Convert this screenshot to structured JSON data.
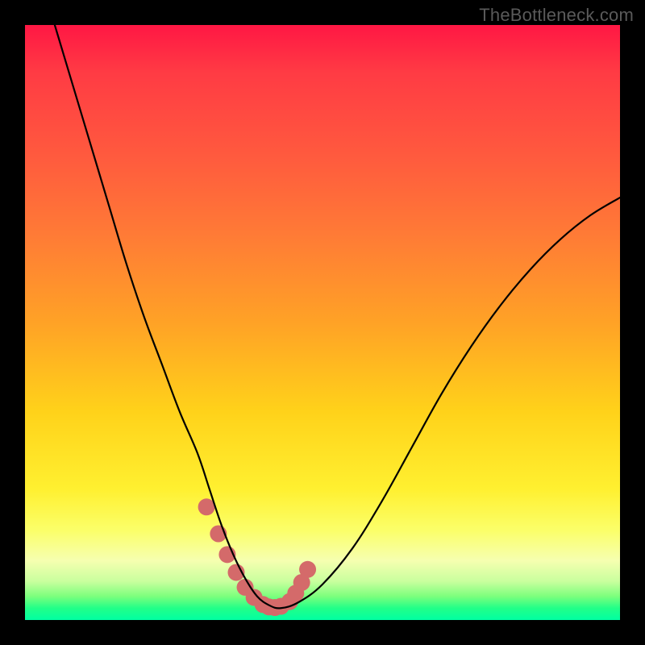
{
  "watermark": "TheBottleneck.com",
  "colors": {
    "frame": "#000000",
    "curve": "#000000",
    "marker": "#d46a6a"
  },
  "chart_data": {
    "type": "line",
    "title": "",
    "xlabel": "",
    "ylabel": "",
    "xlim": [
      0,
      100
    ],
    "ylim": [
      0,
      100
    ],
    "grid": false,
    "legend": false,
    "series": [
      {
        "name": "bottleneck-curve",
        "x": [
          5,
          8,
          11,
          14,
          17,
          20,
          23,
          26,
          29,
          31,
          33,
          35,
          37,
          39,
          41,
          43,
          46,
          50,
          55,
          60,
          65,
          70,
          75,
          80,
          85,
          90,
          95,
          100
        ],
        "y": [
          100,
          90,
          80,
          70,
          60,
          51,
          43,
          35,
          28,
          22,
          16,
          11,
          7,
          4,
          2.5,
          2,
          3,
          6,
          12,
          20,
          29,
          38,
          46,
          53,
          59,
          64,
          68,
          71
        ]
      }
    ],
    "markers": {
      "name": "highlight-dots",
      "x": [
        30.5,
        32.5,
        34,
        35.5,
        37,
        38.5,
        40,
        41,
        42,
        43,
        44.5,
        45.5,
        46.5,
        47.5
      ],
      "y": [
        19,
        14.5,
        11,
        8,
        5.5,
        3.8,
        2.6,
        2.2,
        2.1,
        2.3,
        3.1,
        4.5,
        6.3,
        8.5
      ]
    }
  }
}
